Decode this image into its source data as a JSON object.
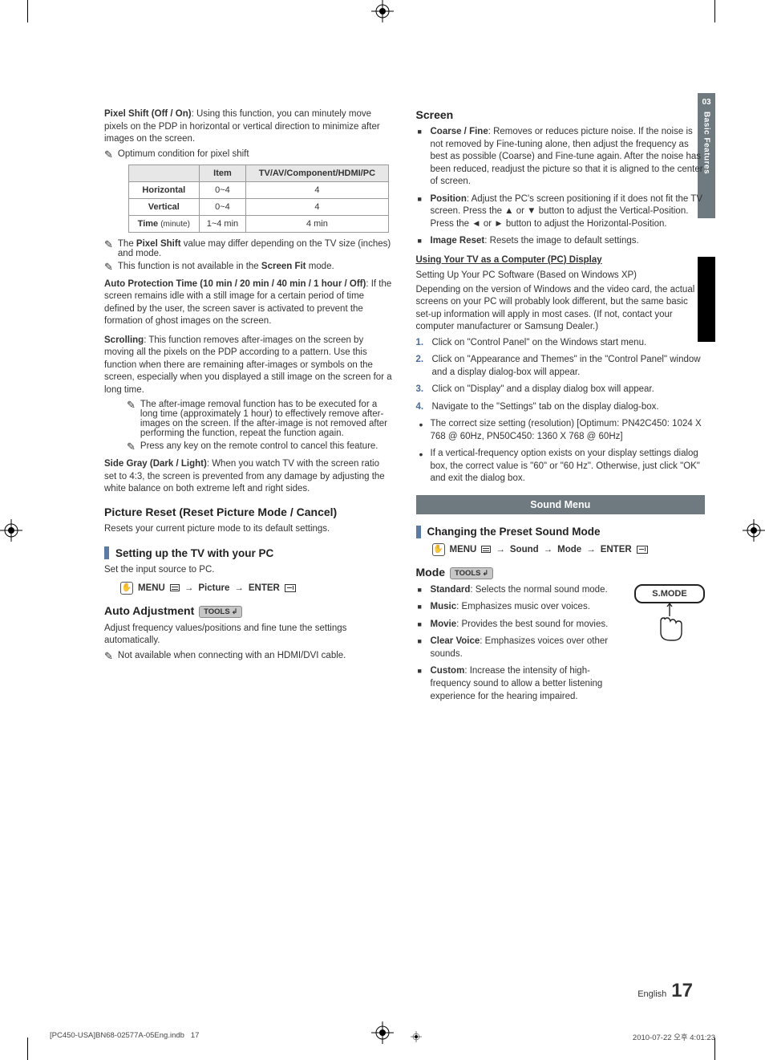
{
  "sideTab": {
    "num": "03",
    "label": "Basic Features"
  },
  "left": {
    "pixelShift": {
      "lead_b": "Pixel Shift (Off / On)",
      "lead_r": ": Using this function, you can minutely move pixels on the PDP in horizontal or vertical direction to minimize after images on the screen.",
      "note1": "Optimum condition for pixel shift",
      "table": {
        "h_blank": "",
        "h_item": "Item",
        "h_comp": "TV/AV/Component/HDMI/PC",
        "rows": [
          {
            "name": "Horizontal",
            "sub": "",
            "item": "0~4",
            "comp": "4"
          },
          {
            "name": "Vertical",
            "sub": "",
            "item": "0~4",
            "comp": "4"
          },
          {
            "name": "Time",
            "sub": "(minute)",
            "item": "1~4 min",
            "comp": "4 min"
          }
        ]
      },
      "note2": "The Pixel Shift value may differ depending on the TV size (inches) and mode.",
      "note3_a": "This function is not available in the ",
      "note3_b": "Screen Fit",
      "note3_c": " mode."
    },
    "autoProt": {
      "lead_b": "Auto Protection Time (10 min / 20 min / 40 min / 1 hour / Off)",
      "lead_r": ": If the screen remains idle with a still image for a certain period of time defined by the user, the screen saver is activated to prevent the formation of ghost images on the screen."
    },
    "scrolling": {
      "lead_b": "Scrolling",
      "lead_r": ": This function removes after-images on the screen by moving all the pixels on the PDP according to a pattern. Use this function when there are remaining after-images or symbols on the screen, especially when you displayed a still image on the screen for a long time.",
      "note1": "The after-image removal function has to be executed for a long time (approximately 1 hour) to effectively remove after-images on the screen. If the after-image is not removed after performing the function, repeat the function again.",
      "note2": "Press any key on the remote control to cancel this feature."
    },
    "sideGray": {
      "lead_b": "Side Gray (Dark / Light)",
      "lead_r": ": When you watch TV with the screen ratio set to 4:3, the screen is prevented from any damage by adjusting the white balance on both extreme left and right sides."
    },
    "pictureReset": {
      "title": "Picture Reset (Reset Picture Mode / Cancel)",
      "desc": "Resets your current picture mode to its default settings."
    },
    "pcSetup": {
      "title": "Setting up the TV with your PC",
      "desc": "Set the input source to PC.",
      "press": {
        "menu": "MENU",
        "p1": "Picture",
        "enter": "ENTER"
      }
    },
    "autoAdj": {
      "title": "Auto Adjustment",
      "tools": "TOOLS",
      "desc": "Adjust frequency values/positions and fine tune the settings automatically.",
      "note": "Not available when connecting with an HDMI/DVI cable."
    }
  },
  "right": {
    "screen": {
      "title": "Screen",
      "items": [
        {
          "b": "Coarse / Fine",
          "r": ": Removes or reduces picture noise. If the noise is not removed by Fine-tuning alone, then adjust the frequency as best as possible (Coarse) and Fine-tune again. After the noise has been reduced, readjust the picture so that it is aligned to the center of screen."
        },
        {
          "b": "Position",
          "r": ": Adjust the PC's screen positioning if it does not fit the TV screen. Press the ▲ or ▼ button to adjust the Vertical-Position. Press the ◄ or ► button to adjust the Horizontal-Position."
        },
        {
          "b": "Image Reset",
          "r": ": Resets the image to default settings."
        }
      ]
    },
    "pcDisplay": {
      "heading": "Using Your TV as a Computer (PC) Display",
      "p1": "Setting Up Your PC Software (Based on Windows XP)",
      "p2": "Depending on the version of Windows and the video card, the actual screens on your PC will probably look different, but the same basic set-up information will apply in most cases. (If not, contact your computer manufacturer or Samsung Dealer.)",
      "steps": [
        "Click on \"Control Panel\" on the Windows start menu.",
        "Click on \"Appearance and Themes\" in the \"Control Panel\" window and a display dialog-box will appear.",
        "Click on \"Display\" and a display dialog box will appear.",
        "Navigate to the \"Settings\" tab on the display dialog-box."
      ],
      "bullets": [
        "The correct size setting (resolution) [Optimum: PN42C450: 1024 X 768 @ 60Hz, PN50C450: 1360 X 768 @ 60Hz]",
        "If a vertical-frequency option exists on your display settings dialog box, the correct value is \"60\" or \"60 Hz\". Otherwise, just click \"OK\" and exit the dialog box."
      ]
    },
    "soundBanner": "Sound Menu",
    "preset": {
      "title": "Changing the Preset Sound Mode",
      "press": {
        "menu": "MENU",
        "p1": "Sound",
        "p2": "Mode",
        "enter": "ENTER"
      }
    },
    "mode": {
      "title": "Mode",
      "tools": "TOOLS",
      "smode": "S.MODE",
      "items": [
        {
          "b": "Standard",
          "r": ": Selects the normal sound mode."
        },
        {
          "b": "Music",
          "r": ": Emphasizes music over voices."
        },
        {
          "b": "Movie",
          "r": ": Provides the best sound for movies."
        },
        {
          "b": "Clear Voice",
          "r": ": Emphasizes voices over other sounds."
        },
        {
          "b": "Custom",
          "r": ": Increase the intensity of high-frequency sound to allow a better listening experience for the hearing impaired."
        }
      ]
    }
  },
  "footer": {
    "lang": "English",
    "page": "17"
  },
  "imposition": {
    "file": "[PC450-USA]BN68-02577A-05Eng.indb",
    "pg": "17",
    "ts": "2010-07-22   오후 4:01:23"
  }
}
